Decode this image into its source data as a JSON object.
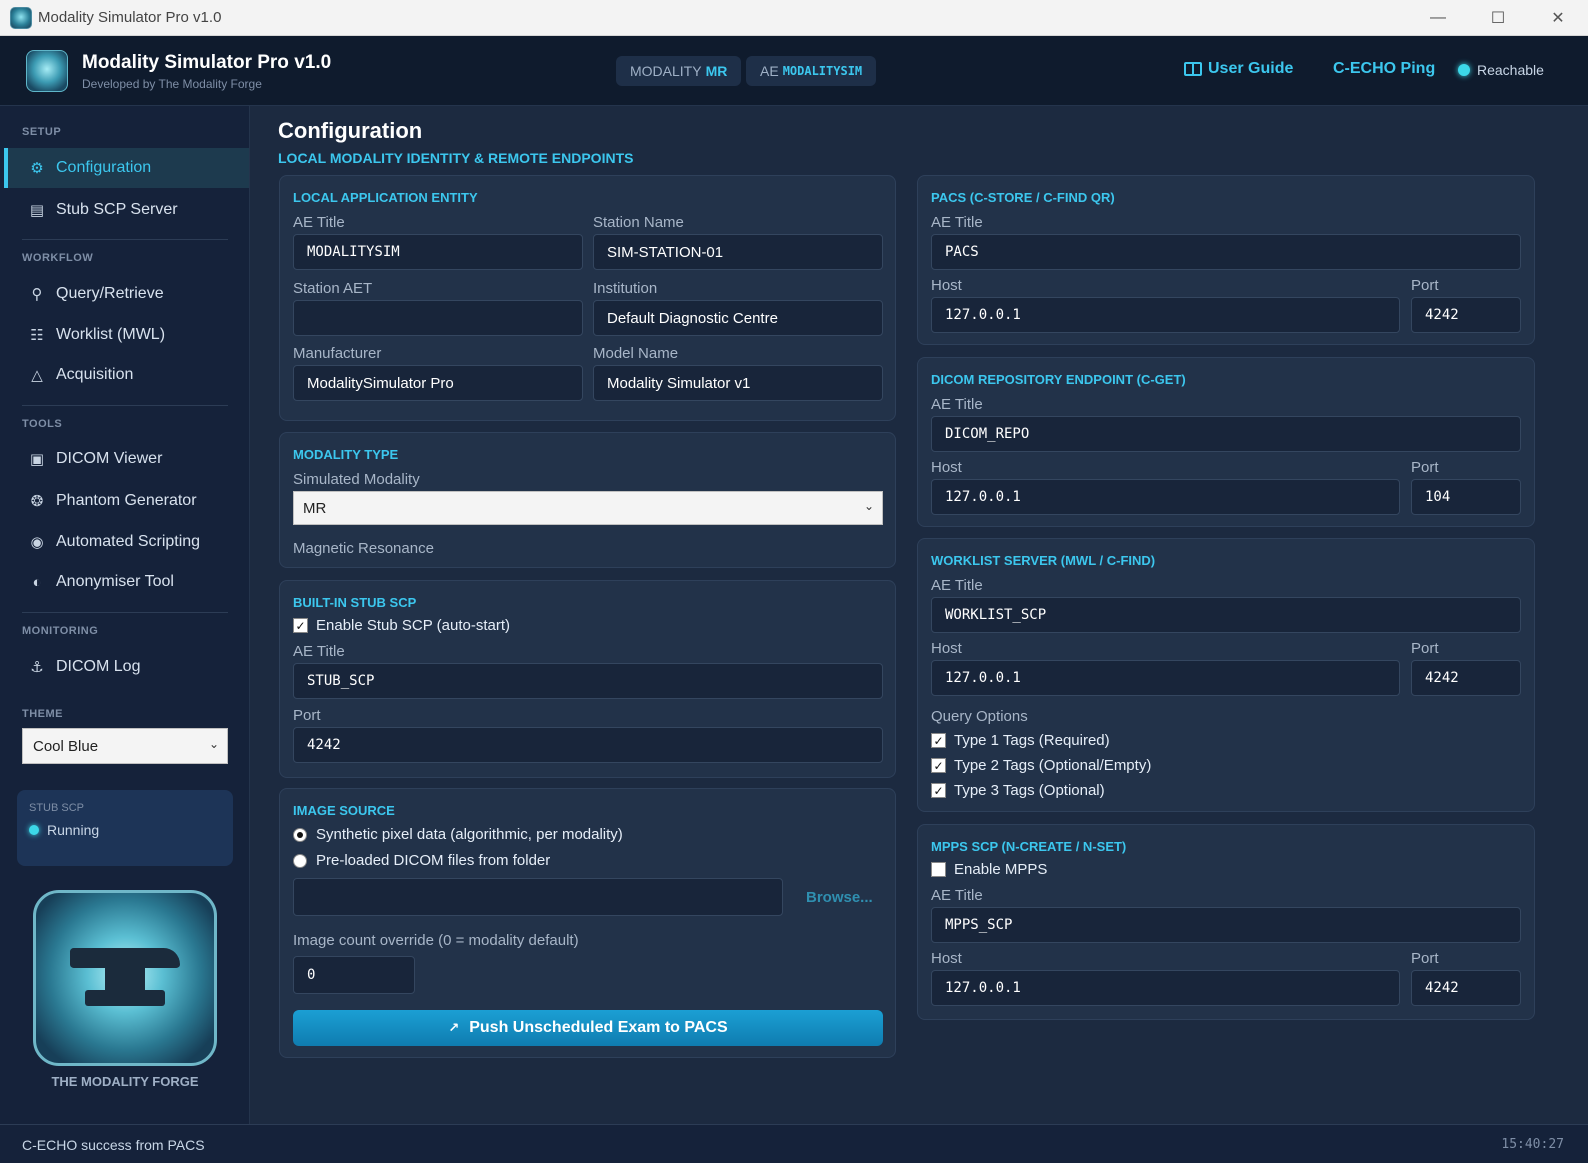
{
  "window": {
    "title": "Modality Simulator Pro v1.0"
  },
  "header": {
    "app_name": "Modality Simulator Pro v1.0",
    "app_sub": "Developed by The Modality Forge",
    "modality_label": "MODALITY",
    "modality_value": "MR",
    "ae_label": "AE",
    "ae_value": "MODALITYSIM",
    "user_guide": "User Guide",
    "echo_ping": "C-ECHO Ping",
    "reachable": "Reachable"
  },
  "sidebar": {
    "sections": {
      "setup": "SETUP",
      "workflow": "WORKFLOW",
      "tools": "TOOLS",
      "monitoring": "MONITORING",
      "theme": "THEME"
    },
    "items": [
      {
        "label": "Configuration",
        "icon": "gear-icon"
      },
      {
        "label": "Stub SCP Server",
        "icon": "server-icon"
      },
      {
        "label": "Query/Retrieve",
        "icon": "magnifier-icon"
      },
      {
        "label": "Worklist (MWL)",
        "icon": "clipboard-icon"
      },
      {
        "label": "Acquisition",
        "icon": "scanner-icon"
      },
      {
        "label": "DICOM Viewer",
        "icon": "image-icon"
      },
      {
        "label": "Phantom Generator",
        "icon": "palette-icon"
      },
      {
        "label": "Automated Scripting",
        "icon": "robot-icon"
      },
      {
        "label": "Anonymiser Tool",
        "icon": "shield-icon"
      },
      {
        "label": "DICOM Log",
        "icon": "microscope-icon"
      }
    ],
    "theme_value": "Cool Blue",
    "stub_label": "STUB SCP",
    "stub_status": "Running",
    "forge_name": "THE MODALITY FORGE"
  },
  "main": {
    "title": "Configuration",
    "subtitle": "LOCAL MODALITY IDENTITY & REMOTE ENDPOINTS",
    "local_ae": {
      "title": "LOCAL APPLICATION ENTITY",
      "ae_title_label": "AE Title",
      "ae_title": "MODALITYSIM",
      "station_name_label": "Station Name",
      "station_name": "SIM-STATION-01",
      "station_aet_label": "Station AET",
      "station_aet": "",
      "institution_label": "Institution",
      "institution": "Default Diagnostic Centre",
      "manufacturer_label": "Manufacturer",
      "manufacturer": "ModalitySimulator Pro",
      "model_label": "Model Name",
      "model": "Modality Simulator v1"
    },
    "modality_type": {
      "title": "MODALITY TYPE",
      "label": "Simulated Modality",
      "value": "MR",
      "description": "Magnetic Resonance"
    },
    "stub_scp": {
      "title": "BUILT-IN STUB SCP",
      "enable_label": "Enable Stub SCP (auto-start)",
      "enabled": true,
      "ae_label": "AE Title",
      "ae_value": "STUB_SCP",
      "port_label": "Port",
      "port_value": "4242"
    },
    "image_source": {
      "title": "IMAGE SOURCE",
      "opt_synthetic": "Synthetic pixel data (algorithmic, per modality)",
      "opt_folder": "Pre-loaded DICOM files from folder",
      "folder_path": "",
      "browse": "Browse...",
      "count_label": "Image count override (0 = modality default)",
      "count_value": "0",
      "push_button": "Push Unscheduled Exam to PACS"
    },
    "pacs": {
      "title": "PACS (C-STORE / C-FIND QR)",
      "ae_label": "AE Title",
      "ae_value": "PACS",
      "host_label": "Host",
      "host_value": "127.0.0.1",
      "port_label": "Port",
      "port_value": "4242"
    },
    "repo": {
      "title": "DICOM REPOSITORY ENDPOINT (C-GET)",
      "ae_label": "AE Title",
      "ae_value": "DICOM_REPO",
      "host_label": "Host",
      "host_value": "127.0.0.1",
      "port_label": "Port",
      "port_value": "104"
    },
    "worklist": {
      "title": "WORKLIST SERVER (MWL / C-FIND)",
      "ae_label": "AE Title",
      "ae_value": "WORKLIST_SCP",
      "host_label": "Host",
      "host_value": "127.0.0.1",
      "port_label": "Port",
      "port_value": "4242",
      "query_label": "Query Options",
      "opt1": "Type 1 Tags (Required)",
      "opt2": "Type 2 Tags (Optional/Empty)",
      "opt3": "Type 3 Tags (Optional)"
    },
    "mpps": {
      "title": "MPPS SCP (N-CREATE / N-SET)",
      "enable_label": "Enable MPPS",
      "ae_label": "AE Title",
      "ae_value": "MPPS_SCP",
      "host_label": "Host",
      "host_value": "127.0.0.1",
      "port_label": "Port",
      "port_value": "4242"
    }
  },
  "statusbar": {
    "message": "C-ECHO success from PACS",
    "time": "15:40:27"
  },
  "colors": {
    "accent": "#3cc7ee",
    "background": "#1c2a40",
    "panel": "#223249"
  }
}
